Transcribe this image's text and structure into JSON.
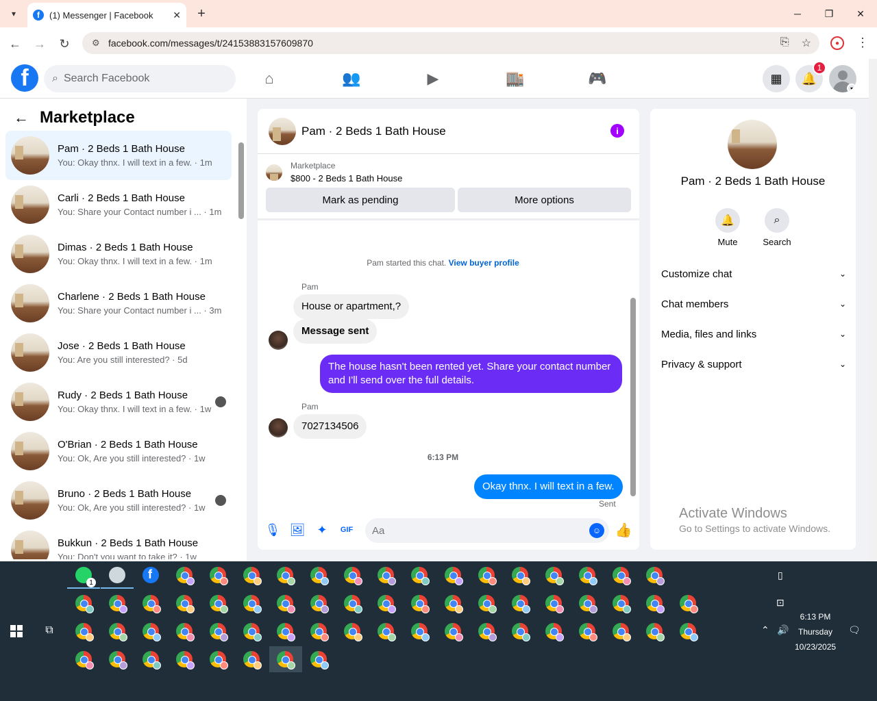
{
  "browser": {
    "tab_title": "(1) Messenger | Facebook",
    "url": "facebook.com/messages/t/24153883157609870"
  },
  "fb": {
    "search_placeholder": "Search Facebook",
    "notif_count": "1"
  },
  "left": {
    "title": "Marketplace",
    "conversations": [
      {
        "name": "Pam · 2 Beds 1 Bath House",
        "preview": "You: Okay thnx. I will text in a few. · 1m"
      },
      {
        "name": "Carli · 2 Beds 1 Bath House",
        "preview": "You: Share your Contact number i ... · 1m"
      },
      {
        "name": "Dimas · 2 Beds 1 Bath House",
        "preview": "You: Okay thnx. I will text in a few. · 1m"
      },
      {
        "name": "Charlene · 2 Beds 1 Bath House",
        "preview": "You: Share your Contact number i ... · 3m"
      },
      {
        "name": "Jose · 2 Beds 1 Bath House",
        "preview": "You: Are you still interested? · 5d"
      },
      {
        "name": "Rudy · 2 Beds 1 Bath House",
        "preview": "You: Okay thnx. I will text in a few. · 1w"
      },
      {
        "name": "O'Brian · 2 Beds 1 Bath House",
        "preview": "You: Ok, Are you still interested? · 1w"
      },
      {
        "name": "Bruno · 2 Beds 1 Bath House",
        "preview": "You: Ok, Are you still interested? · 1w"
      },
      {
        "name": "Bukkun · 2 Beds 1 Bath House",
        "preview": "You: Don't you want to take it? · 1w"
      }
    ]
  },
  "chat": {
    "title": "Pam · 2 Beds 1 Bath House",
    "marketplace_label": "Marketplace",
    "listing": "$800 - 2 Beds 1 Bath House",
    "mark_pending": "Mark as pending",
    "more_options": "More options",
    "started": "Pam started this chat.",
    "view_buyer": "View buyer profile",
    "sender1": "Pam",
    "msg1": "House or apartment,?",
    "msg2": "Message sent",
    "msg3": "The house hasn't been rented yet. Share your contact number and I'll send over the full details.",
    "sender2": "Pam",
    "msg4": "7027134506",
    "time": "6:13 PM",
    "msg5": "Okay thnx. I will text in a few.",
    "sent": "Sent",
    "input_placeholder": "Aa"
  },
  "right": {
    "name": "Pam · 2 Beds 1 Bath House",
    "mute": "Mute",
    "search": "Search",
    "rows": [
      "Customize chat",
      "Chat members",
      "Media, files and links",
      "Privacy & support"
    ],
    "watermark_title": "Activate Windows",
    "watermark_sub": "Go to Settings to activate Windows."
  },
  "taskbar": {
    "time": "6:13 PM",
    "day": "Thursday",
    "date": "10/23/2025",
    "whatsapp_badge": "1"
  }
}
